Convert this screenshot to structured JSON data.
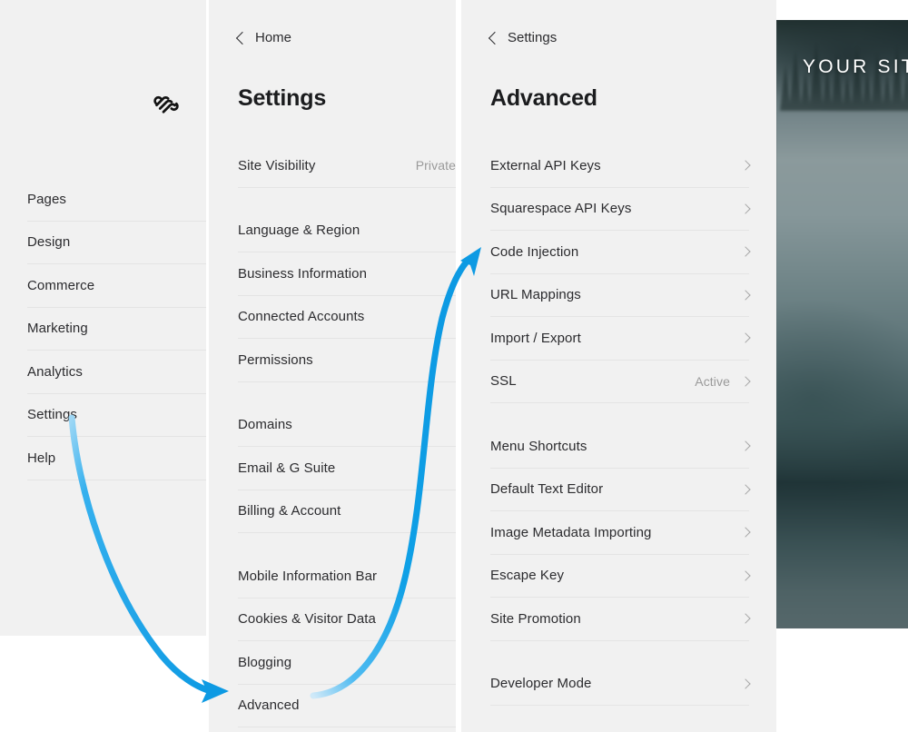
{
  "sidebar": {
    "logo_icon": "squarespace-logo",
    "items": [
      {
        "label": "Pages"
      },
      {
        "label": "Design"
      },
      {
        "label": "Commerce"
      },
      {
        "label": "Marketing"
      },
      {
        "label": "Analytics"
      },
      {
        "label": "Settings"
      },
      {
        "label": "Help"
      }
    ]
  },
  "settings_panel": {
    "back_label": "Home",
    "back_icon": "chevron-left-icon",
    "title": "Settings",
    "groups": [
      {
        "rows": [
          {
            "label": "Site Visibility",
            "value": "Private"
          }
        ]
      },
      {
        "rows": [
          {
            "label": "Language & Region",
            "value": ""
          },
          {
            "label": "Business Information",
            "value": ""
          },
          {
            "label": "Connected Accounts",
            "value": ""
          },
          {
            "label": "Permissions",
            "value": ""
          }
        ]
      },
      {
        "rows": [
          {
            "label": "Domains",
            "value": ""
          },
          {
            "label": "Email & G Suite",
            "value": ""
          },
          {
            "label": "Billing & Account",
            "value": ""
          }
        ]
      },
      {
        "rows": [
          {
            "label": "Mobile Information Bar",
            "value": ""
          },
          {
            "label": "Cookies & Visitor Data",
            "value": ""
          },
          {
            "label": "Blogging",
            "value": ""
          },
          {
            "label": "Advanced",
            "value": ""
          }
        ]
      }
    ]
  },
  "advanced_panel": {
    "back_label": "Settings",
    "back_icon": "chevron-left-icon",
    "title": "Advanced",
    "groups": [
      {
        "rows": [
          {
            "label": "External API Keys",
            "value": ""
          },
          {
            "label": "Squarespace API Keys",
            "value": ""
          },
          {
            "label": "Code Injection",
            "value": ""
          },
          {
            "label": "URL Mappings",
            "value": ""
          },
          {
            "label": "Import / Export",
            "value": ""
          },
          {
            "label": "SSL",
            "value": "Active"
          }
        ]
      },
      {
        "rows": [
          {
            "label": "Menu Shortcuts",
            "value": ""
          },
          {
            "label": "Default Text Editor",
            "value": ""
          },
          {
            "label": "Image Metadata Importing",
            "value": ""
          },
          {
            "label": "Escape Key",
            "value": ""
          },
          {
            "label": "Site Promotion",
            "value": ""
          }
        ]
      },
      {
        "rows": [
          {
            "label": "Developer Mode",
            "value": ""
          }
        ]
      }
    ]
  },
  "site_preview": {
    "title": "YOUR SITE"
  },
  "annotations": {
    "arrow_color": "#1ba1e8",
    "arrows": [
      {
        "name": "settings-to-advanced",
        "from": "Settings",
        "to": "Advanced"
      },
      {
        "name": "advanced-to-code-injection",
        "from": "Advanced",
        "to": "Code Injection"
      }
    ]
  },
  "colors": {
    "panel_bg": "#f1f1f1",
    "divider": "#e4e4e4",
    "text": "#2b2b2e",
    "muted_text": "#9a9a9a",
    "accent": "#1ba1e8"
  }
}
